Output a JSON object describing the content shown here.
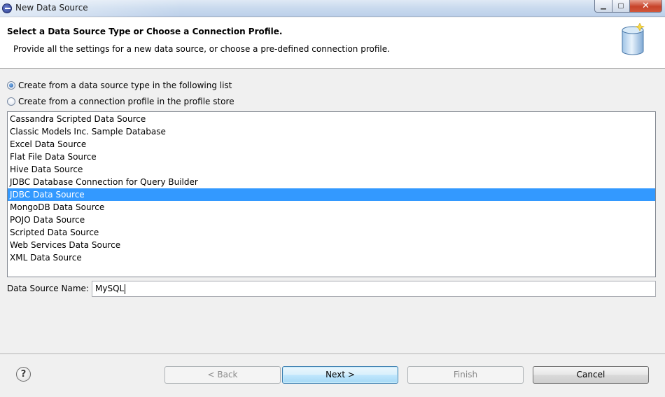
{
  "window": {
    "title": "New Data Source",
    "minimize_glyph": "▁",
    "maximize_glyph": "▢",
    "close_glyph": "✕"
  },
  "header": {
    "title": "Select a Data Source Type or Choose a Connection Profile.",
    "description": "Provide all the settings for a new data source, or choose a pre-defined connection profile.",
    "icon": "database-icon"
  },
  "options": {
    "from_type_label": "Create from a data source type in the following list",
    "from_profile_label": "Create from a connection profile in the profile store",
    "selected": "from_type"
  },
  "data_sources": {
    "items": [
      "Cassandra Scripted Data Source",
      "Classic Models Inc. Sample Database",
      "Excel Data Source",
      "Flat File Data Source",
      "Hive Data Source",
      "JDBC Database Connection for Query Builder",
      "JDBC Data Source",
      "MongoDB Data Source",
      "POJO Data Source",
      "Scripted Data Source",
      "Web Services Data Source",
      "XML Data Source"
    ],
    "selected_index": 6
  },
  "name_field": {
    "label": "Data Source Name:",
    "value": "MySQL"
  },
  "buttons": {
    "help": "?",
    "back": "< Back",
    "next": "Next >",
    "finish": "Finish",
    "cancel": "Cancel"
  },
  "colors": {
    "selection": "#3399ff",
    "default_button_border": "#3c7fb1"
  }
}
